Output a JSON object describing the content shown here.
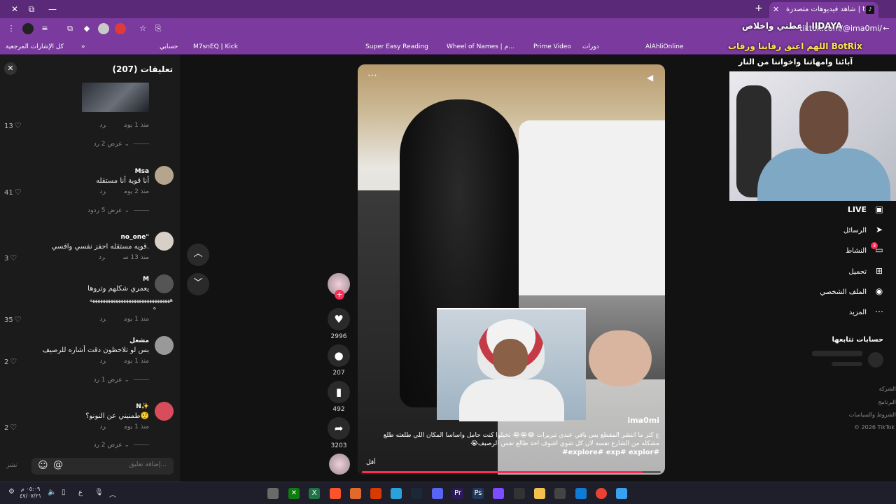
{
  "browser": {
    "active_tab_title": "شاهد فيديوهات متصدرة | tik",
    "url": "tiktok.com/@ima0mi/",
    "overlay_top": "عطني واخلاص | IIDAYA",
    "overlay_bookmarks": "اللهم اعتق رقابنا ورقاب BotRix",
    "bookmarks": [
      "AlAhliOnline",
      "دورات",
      "Prime Video",
      "Wheel of Names | م...",
      "Super Easy Reading",
      "M7snEQ | Kick",
      "حسابي",
      "كل الإشارات المرجعية"
    ],
    "window_close": "✕",
    "window_max": "⧉",
    "window_min": "—",
    "new_tab": "+",
    "tab_close": "✕"
  },
  "overlay_name": "آبائنا وامهاتنا واخواننا من النار",
  "comments": {
    "title": "تعليقات (207)",
    "items": [
      {
        "time": "منذ 1 يوم",
        "reply": "رد",
        "likes": "13",
        "replies": "عرض 2 رد"
      },
      {
        "name": "Msa",
        "text": "أنا قوية أنا مستقله",
        "time": "منذ 2 يوم",
        "reply": "رد",
        "likes": "41",
        "replies": "عرض 5 ردود"
      },
      {
        "name": "no_one\"",
        "text": "قويه مستقله احفز نفسي وافسي.",
        "time": "منذ 13 س",
        "reply": "رد",
        "likes": "3"
      },
      {
        "name": "M",
        "text": "يعمري شكلهم وتروها",
        "text2": "هههههههههههههههههههههههههههههههه",
        "text3": "ه",
        "time": "منذ 1 يوم",
        "reply": "رد",
        "likes": "35"
      },
      {
        "name": "مشعل",
        "text": "بس لو تلاحظون دقت أشاره للرصيف",
        "time": "منذ 1 يوم",
        "reply": "رد",
        "likes": "2",
        "replies": "عرض 1 رد"
      },
      {
        "name": "N✨",
        "text": "طمنيني عن النونو؟🤨",
        "time": "منذ 1 يوم",
        "reply": "رد",
        "likes": "2",
        "replies": "عرض 2 رد"
      }
    ],
    "input_placeholder": "إضافة تعليق...",
    "post_label": "نشر"
  },
  "video": {
    "author": "ima0mi",
    "caption": "ع كثر ما انتشر المقطع بس باقي عندي تبريرات 😂😭😭 تخيلوا كنت حامل واساسا المكان اللي طلعته طلع مشكله من الشارع نفسه لان كل شوي اشوف احد طالع نفس الرصيف😭",
    "hashtags": "#explore# exp# explor#",
    "less": "أقل",
    "progress": 0.94,
    "likes": "2996",
    "comments": "207",
    "saves": "492",
    "shares": "3203"
  },
  "sidebar": {
    "nav": [
      "LIVE",
      "الرسائل",
      "النشاط",
      "تحميل",
      "الملف الشخصي",
      "المزيد"
    ],
    "badge": "3",
    "following_title": "حسابات تتابعها",
    "footer": [
      "الشركة",
      "البرنامج",
      "الشروط والسياسات",
      "© 2026 TikTok"
    ]
  },
  "taskbar": {
    "time": "٠٥:٠٩ م",
    "date": "٤٧/٠٧/٢١",
    "lang": "ع"
  }
}
